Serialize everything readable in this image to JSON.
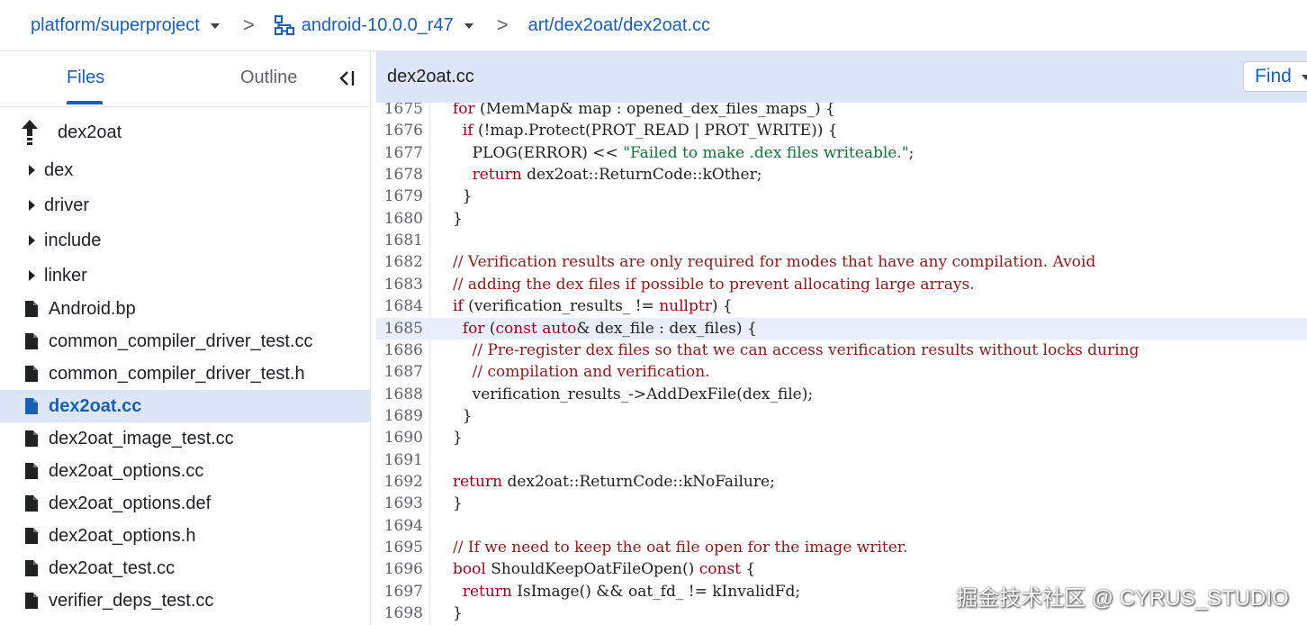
{
  "breadcrumb": {
    "project": "platform/superproject",
    "branch": "android-10.0.0_r47",
    "path": "art/dex2oat/dex2oat.cc",
    "separator": ">"
  },
  "sidebar": {
    "tabs": {
      "files": "Files",
      "outline": "Outline"
    },
    "parent": "dex2oat",
    "items": [
      {
        "label": "dex",
        "type": "folder"
      },
      {
        "label": "driver",
        "type": "folder"
      },
      {
        "label": "include",
        "type": "folder"
      },
      {
        "label": "linker",
        "type": "folder"
      },
      {
        "label": "Android.bp",
        "type": "file"
      },
      {
        "label": "common_compiler_driver_test.cc",
        "type": "file"
      },
      {
        "label": "common_compiler_driver_test.h",
        "type": "file"
      },
      {
        "label": "dex2oat.cc",
        "type": "file",
        "selected": true
      },
      {
        "label": "dex2oat_image_test.cc",
        "type": "file"
      },
      {
        "label": "dex2oat_options.cc",
        "type": "file"
      },
      {
        "label": "dex2oat_options.def",
        "type": "file"
      },
      {
        "label": "dex2oat_options.h",
        "type": "file"
      },
      {
        "label": "dex2oat_test.cc",
        "type": "file"
      },
      {
        "label": "verifier_deps_test.cc",
        "type": "file"
      }
    ]
  },
  "code": {
    "filename": "dex2oat.cc",
    "find_label": "Find",
    "highlighted_line": "1685",
    "lines": [
      {
        "n": "1675",
        "t": "for (MemMap& map : opened_dex_files_maps_) {"
      },
      {
        "n": "1676",
        "t": "  if (!map.Protect(PROT_READ | PROT_WRITE)) {"
      },
      {
        "n": "1677",
        "t": "    PLOG(ERROR) << \"Failed to make .dex files writeable.\";"
      },
      {
        "n": "1678",
        "t": "    return dex2oat::ReturnCode::kOther;"
      },
      {
        "n": "1679",
        "t": "  }"
      },
      {
        "n": "1680",
        "t": "}"
      },
      {
        "n": "1681",
        "t": ""
      },
      {
        "n": "1682",
        "t": "// Verification results are only required for modes that have any compilation. Avoid"
      },
      {
        "n": "1683",
        "t": "// adding the dex files if possible to prevent allocating large arrays."
      },
      {
        "n": "1684",
        "t": "if (verification_results_ != nullptr) {"
      },
      {
        "n": "1685",
        "t": "  for (const auto& dex_file : dex_files) {"
      },
      {
        "n": "1686",
        "t": "    // Pre-register dex files so that we can access verification results without locks during"
      },
      {
        "n": "1687",
        "t": "    // compilation and verification."
      },
      {
        "n": "1688",
        "t": "    verification_results_->AddDexFile(dex_file);"
      },
      {
        "n": "1689",
        "t": "  }"
      },
      {
        "n": "1690",
        "t": "}"
      },
      {
        "n": "1691",
        "t": ""
      },
      {
        "n": "1692",
        "t": "return dex2oat::ReturnCode::kNoFailure;"
      },
      {
        "n": "1693",
        "t": "}"
      },
      {
        "n": "1694",
        "t": ""
      },
      {
        "n": "1695",
        "t": "// If we need to keep the oat file open for the image writer."
      },
      {
        "n": "1696",
        "t": "bool ShouldKeepOatFileOpen() const {"
      },
      {
        "n": "1697",
        "t": "  return IsImage() && oat_fd_ != kInvalidFd;"
      },
      {
        "n": "1698",
        "t": "}"
      }
    ]
  },
  "watermark": "掘金技术社区 @ CYRUS_STUDIO",
  "colors": {
    "accent": "#1a5fb4",
    "selected_bg": "#dde6f7",
    "keyword": "#a1001a",
    "string": "#137333"
  }
}
